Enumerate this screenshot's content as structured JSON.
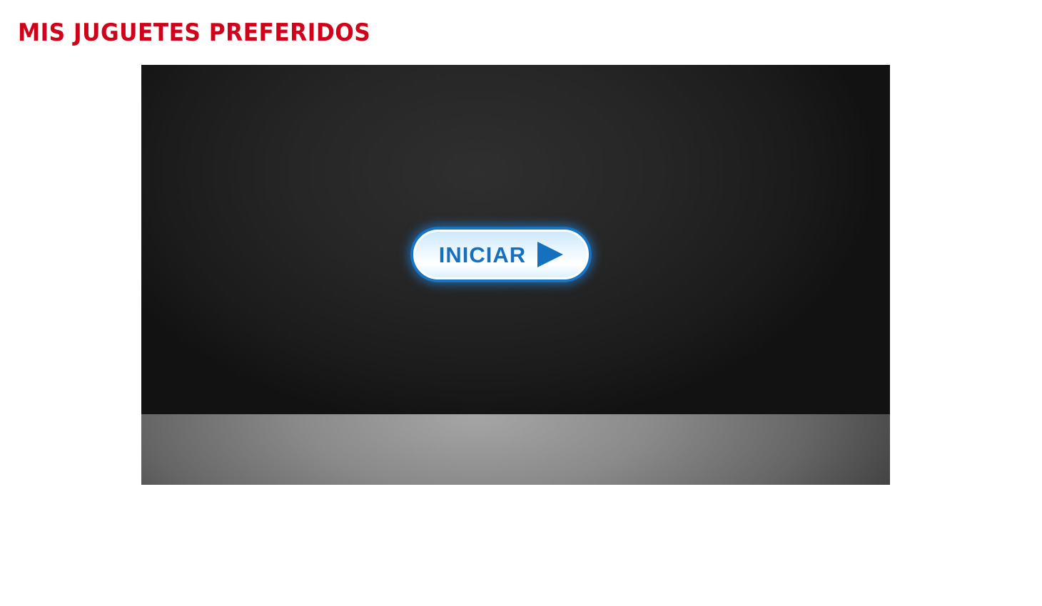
{
  "page": {
    "title": "MIS JUGUETES PREFERIDOS"
  },
  "player": {
    "start_button_label": "INICIAR",
    "start_button_icon": "play-icon"
  },
  "colors": {
    "title": "#d0021b",
    "button_accent": "#1570c0",
    "stage_background": "#1e1e1e",
    "stage_floor": "#8a8a8a"
  }
}
